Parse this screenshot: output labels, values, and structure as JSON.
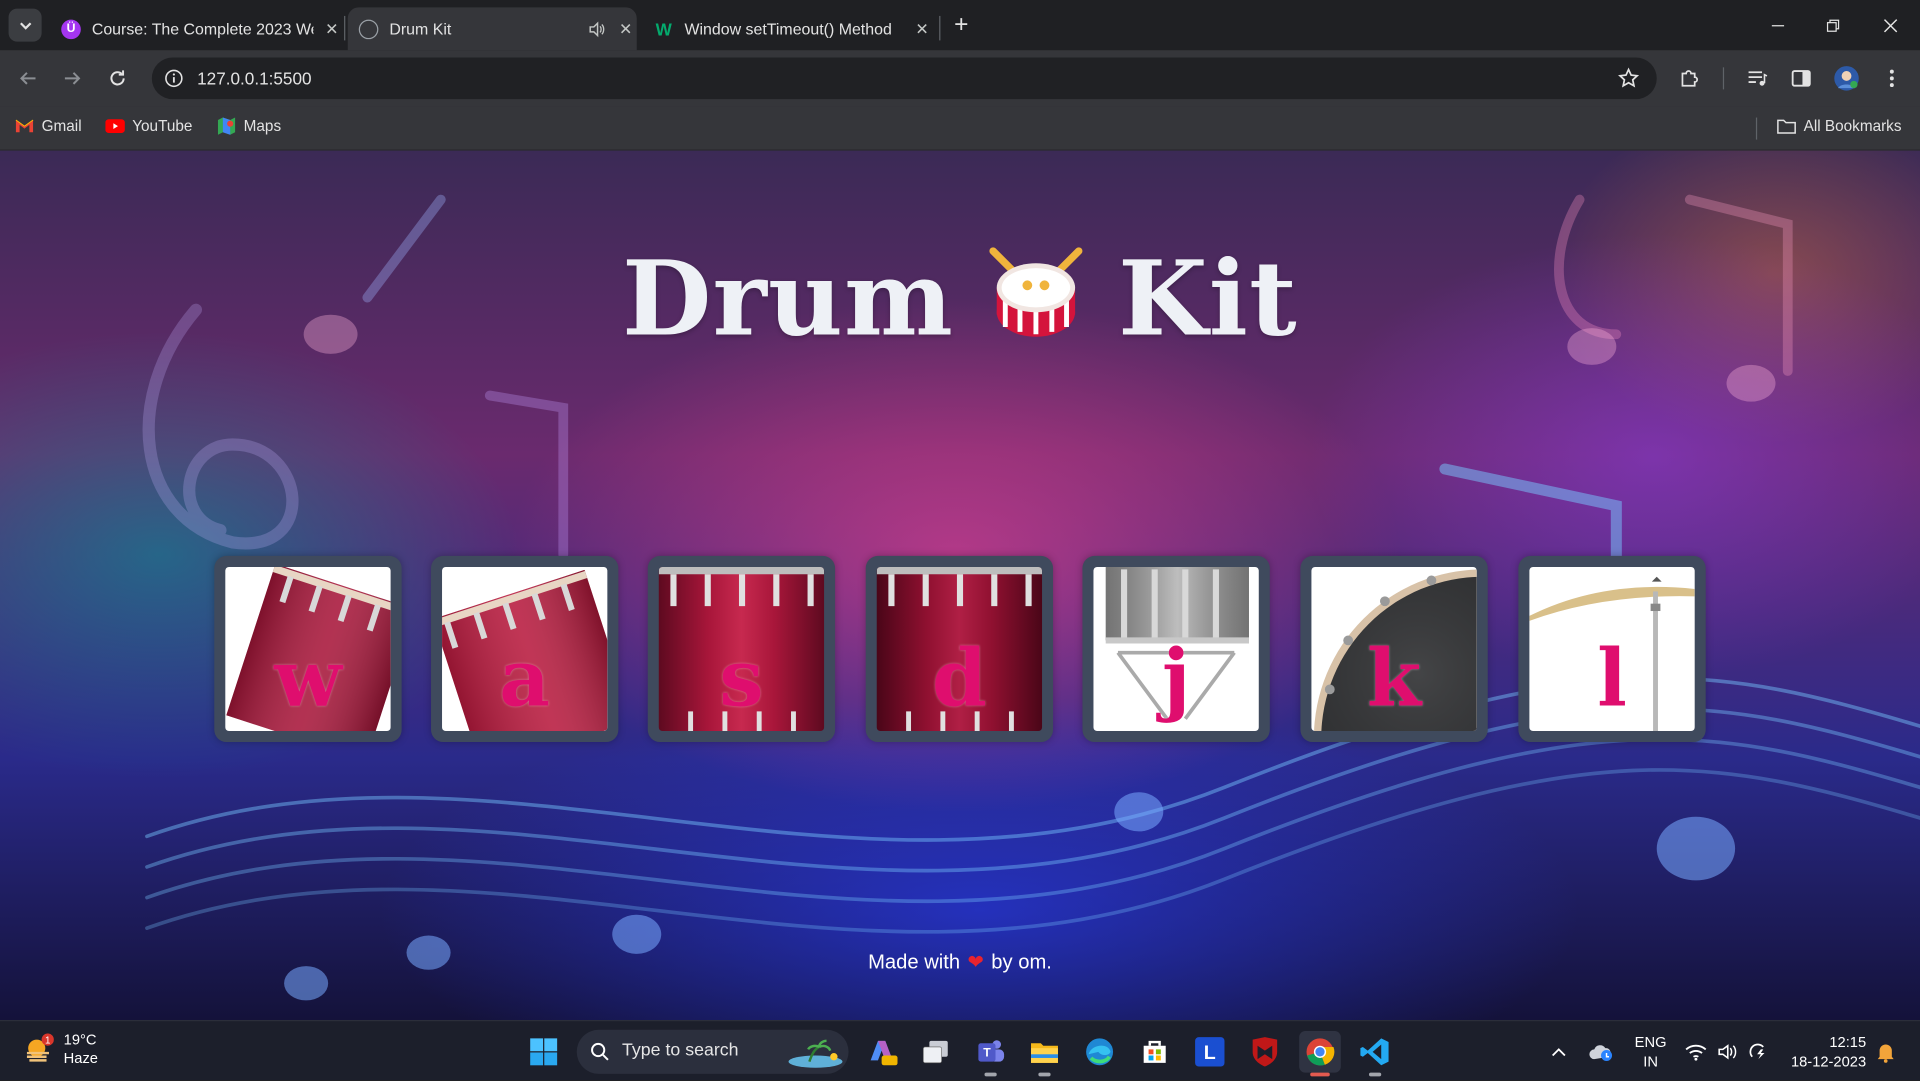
{
  "browser": {
    "tabs": [
      {
        "title": "Course: The Complete 2023 We",
        "icon": "udemy-icon"
      },
      {
        "title": "Drum Kit",
        "icon": "globe-icon",
        "audio": true
      },
      {
        "title": "Window setTimeout() Method",
        "icon": "w3schools-icon"
      }
    ],
    "active_tab": 1,
    "url": "127.0.0.1:5500",
    "bookmarks": [
      {
        "label": "Gmail"
      },
      {
        "label": "YouTube"
      },
      {
        "label": "Maps"
      }
    ],
    "all_bookmarks": "All Bookmarks"
  },
  "page": {
    "title_left": "Drum",
    "title_right": "Kit",
    "drums": [
      {
        "key": "w",
        "kind": "tom-tilt"
      },
      {
        "key": "a",
        "kind": "tom-tilt"
      },
      {
        "key": "s",
        "kind": "tom-side"
      },
      {
        "key": "d",
        "kind": "tom-side"
      },
      {
        "key": "j",
        "kind": "snare"
      },
      {
        "key": "k",
        "kind": "kick"
      },
      {
        "key": "l",
        "kind": "crash"
      }
    ],
    "footer_prefix": "Made with",
    "footer_suffix": "by om."
  },
  "taskbar": {
    "weather_temp": "19°C",
    "weather_desc": "Haze",
    "weather_badge": "1",
    "search_placeholder": "Type to search",
    "lang_top": "ENG",
    "lang_bottom": "IN",
    "time": "12:15",
    "date": "18-12-2023"
  },
  "colors": {
    "letter": "#df0e6e",
    "frame": "#3f4a5d",
    "tab_strip": "#1f2023",
    "toolbar": "#35363a"
  }
}
